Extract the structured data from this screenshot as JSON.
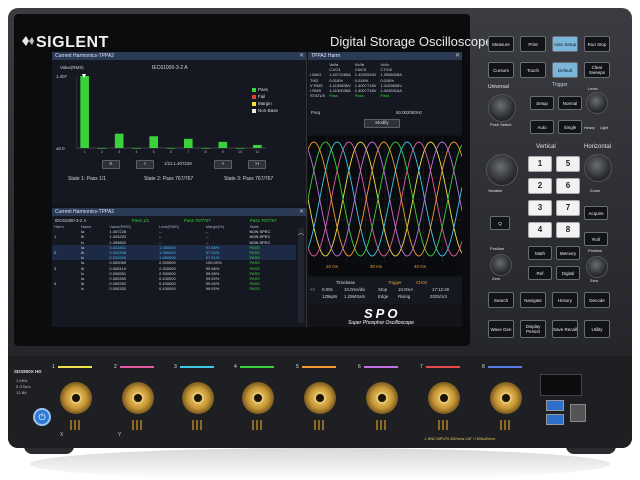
{
  "device": {
    "brand": "SIGLENT",
    "title": "Digital Storage Oscilloscope",
    "model_badge": "SDS800X HD",
    "spo_logo": "SPO",
    "spo_tagline": "Super Phosphor Oscilloscope",
    "left_port_labels": [
      "1 MHz",
      "5 GSa/s",
      "12-Bit"
    ],
    "warning_label": "BNC INPUTS 300Vrms CAT I / 50Ω≤5Vrms",
    "x_label": "X",
    "y_label": "Y"
  },
  "harmonics_chart": {
    "header": "Current Harmonics-TPPA2",
    "ylabel": "Value(RMS)",
    "subtitle": "IEC61000-3-2 A",
    "ytop_label": "1.407",
    "ybottom_label": "±0.0",
    "legend": [
      {
        "label": "Pass",
        "color": "#3ad13a"
      },
      {
        "label": "Fail",
        "color": "#e23b3b"
      },
      {
        "label": "Margin",
        "color": "#f0e23a"
      },
      {
        "label": "Non-Base",
        "color": "#e8e8e8"
      }
    ],
    "nav_center_label": "1/11:1.407228",
    "states": [
      "State 1: Pass 1/1",
      "State 2: Pass 767/767",
      "State 3: Pass 767/767"
    ]
  },
  "chart_data": {
    "type": "bar",
    "categories": [
      "1",
      "2",
      "3",
      "4",
      "5",
      "6",
      "7",
      "8",
      "9",
      "10",
      "11"
    ],
    "values": [
      1.407,
      0.0,
      0.28,
      0.0,
      0.23,
      0.0,
      0.18,
      0.0,
      0.12,
      0.0,
      0.06
    ],
    "ylim": [
      0,
      1.407
    ]
  },
  "harm_table": {
    "header": "Current Harmonics-TPPA2",
    "summary": {
      "standard": "IEC61000-3-2 A",
      "pass1": "Pass 1/1",
      "pass2": "Pass 767/767",
      "pass3": "Pass 767/767"
    },
    "columns": [
      "Harm",
      "Name",
      "Value(RMS)",
      "Limit(RMS)",
      "Margin(%)",
      "State"
    ],
    "rows": [
      {
        "harm": "",
        "name": "Ia",
        "value": "1.407228",
        "limit": "--",
        "margin": "--",
        "state": "NON SPEC"
      },
      {
        "harm": "1",
        "name": "Ib",
        "value": "1.403253",
        "limit": "--",
        "margin": "--",
        "state": "NON SPEC"
      },
      {
        "harm": "",
        "name": "Ic",
        "value": "1.399802",
        "limit": "--",
        "margin": "--",
        "state": "NON SPEC"
      },
      {
        "harm": "",
        "name": "Ia",
        "value": "0.022801",
        "limit": "1.080000",
        "margin": "97.88%",
        "state": "PASS"
      },
      {
        "harm": "2",
        "name": "Ib",
        "value": "0.022308",
        "limit": "1.080000",
        "margin": "97.93%",
        "state": "PASS"
      },
      {
        "harm": "",
        "name": "Ic",
        "value": "0.022993",
        "limit": "1.080000",
        "margin": "97.91%",
        "state": "PASS"
      },
      {
        "harm": "",
        "name": "Ia",
        "value": "0.000069",
        "limit": "2.300000",
        "margin": "100.00%",
        "state": "PASS"
      },
      {
        "harm": "3",
        "name": "Ib",
        "value": "0.000419",
        "limit": "2.300000",
        "margin": "99.98%",
        "state": "PASS"
      },
      {
        "harm": "",
        "name": "Ic",
        "value": "0.000551",
        "limit": "2.300000",
        "margin": "99.98%",
        "state": "PASS"
      },
      {
        "harm": "",
        "name": "Ia",
        "value": "0.000350",
        "limit": "0.430000",
        "margin": "99.92%",
        "state": "PASS"
      },
      {
        "harm": "4",
        "name": "Ib",
        "value": "0.000252",
        "limit": "0.430000",
        "margin": "99.94%",
        "state": "PASS"
      },
      {
        "harm": "",
        "name": "Ic",
        "value": "0.000332",
        "limit": "0.430000",
        "margin": "99.92%",
        "state": "PASS"
      }
    ]
  },
  "power_panel": {
    "header": "TPPA2 Harm",
    "columns": [
      "",
      "Va/Ia",
      "Vb/Ib",
      "Vc/Ic"
    ],
    "sub": [
      "",
      "C1/C4",
      "C5/C5",
      "C7/C8"
    ],
    "rows": [
      {
        "label": "I MAG",
        "a": "1.4072285A",
        "b": "1.4032534V",
        "c": "1.3996028A"
      },
      {
        "label": "THD",
        "a": "0.018%",
        "b": "0.018%",
        "c": "0.018%"
      },
      {
        "label": "V RMS",
        "a": "1.4135835V",
        "b": "1.4007718V",
        "c": "1.4109636V"
      },
      {
        "label": "I RMS",
        "a": "1.4130038A",
        "b": "1.4007718V",
        "c": "1.4045316A"
      },
      {
        "label": "STATUS",
        "a": "Pass",
        "b": "Pass",
        "c": "Pass"
      }
    ],
    "freq_label": "Freq",
    "freq_value": "50.002083Hz",
    "modify_label": "Modify"
  },
  "waveform": {
    "time_labels": [
      "20 ms",
      "30 ms",
      "40 ms"
    ],
    "colors": [
      "#f0e04a",
      "#e35aa0",
      "#3fc8e6",
      "#3ad13a",
      "#f29a2e",
      "#c070e0"
    ]
  },
  "status_bar": {
    "timebase_title": "Timebase",
    "trigger_title": "Trigger",
    "trigger_mode": "CH01",
    "line1": [
      "0.00s",
      "10.0ms/div",
      "Stop",
      "10.0mA"
    ],
    "line2": [
      "125kpts",
      "1.25MSa/s",
      "Edge",
      "Rising"
    ],
    "clock_time": "17:12:49",
    "clock_date": "2025/1/4"
  },
  "panel": {
    "row1": [
      "Measure",
      "Print",
      "Auto Setup",
      "Run Stop"
    ],
    "row2": [
      "Cursors",
      "Touch",
      "Default",
      "Clear Sweeps"
    ],
    "universal_label": "Universal",
    "push_select": "Push Select",
    "trigger_label": "Trigger",
    "trigger_buttons": [
      "Setup",
      "Normal",
      "Auto",
      "Single"
    ],
    "level_label": "Level",
    "heavy_light": [
      "Heavy",
      "Light"
    ],
    "vertical_label": "Vertical",
    "horizontal_label": "Horizontal",
    "channel_numbers": [
      "1",
      "5",
      "2",
      "6",
      "3",
      "7",
      "4",
      "8"
    ],
    "vertical_buttons": [
      "Math",
      "Memory",
      "Ref",
      "Digital"
    ],
    "horizontal_buttons": [
      "Acquire",
      "Roll"
    ],
    "zoom_label": "Zoom",
    "variable_label": "Variable",
    "position_labels": [
      "Position",
      "Position"
    ],
    "zero_labels": [
      "Zero",
      "Zero"
    ],
    "search_icon_label": "Q",
    "bottom_row1": [
      "Search",
      "Navigate",
      "History",
      "Decode"
    ],
    "bottom_row2": [
      "Wave Gen",
      "Display Persist",
      "Save Recall",
      "Utility"
    ]
  },
  "channels": [
    {
      "num": "1",
      "color": "#f0e04a"
    },
    {
      "num": "2",
      "color": "#e35aa0"
    },
    {
      "num": "3",
      "color": "#3fc8e6"
    },
    {
      "num": "4",
      "color": "#3ad13a"
    },
    {
      "num": "5",
      "color": "#f29a2e"
    },
    {
      "num": "6",
      "color": "#c070e0"
    },
    {
      "num": "7",
      "color": "#e84a4a"
    },
    {
      "num": "8",
      "color": "#5a7ee8"
    }
  ]
}
